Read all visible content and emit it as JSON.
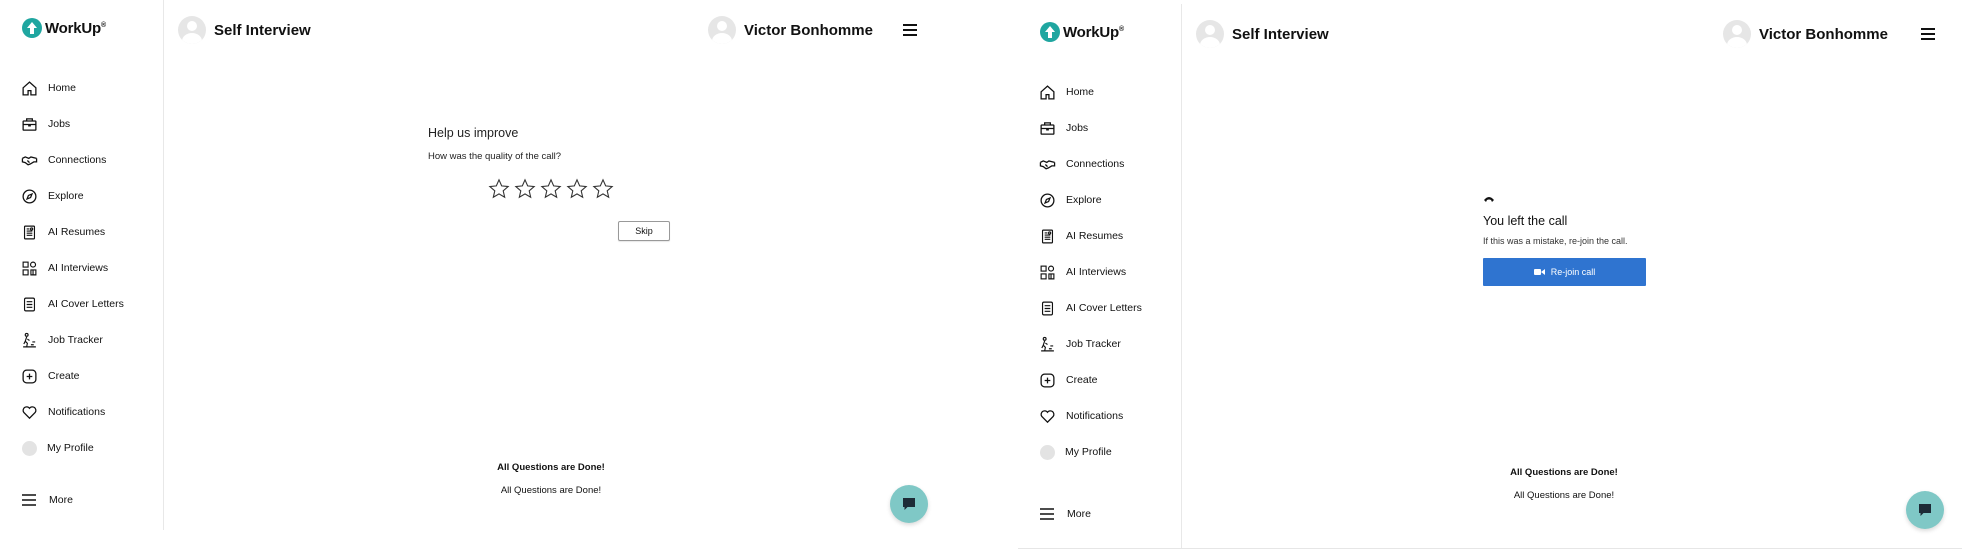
{
  "app": {
    "logo_text": "WorkUp",
    "logo_tm": "®"
  },
  "sidebar": {
    "items": [
      {
        "label": "Home",
        "icon": "home-icon"
      },
      {
        "label": "Jobs",
        "icon": "briefcase-icon"
      },
      {
        "label": "Connections",
        "icon": "handshake-icon"
      },
      {
        "label": "Explore",
        "icon": "compass-icon"
      },
      {
        "label": "AI Resumes",
        "icon": "resume-icon"
      },
      {
        "label": "AI Interviews",
        "icon": "interview-icon"
      },
      {
        "label": "AI Cover Letters",
        "icon": "document-icon"
      },
      {
        "label": "Job Tracker",
        "icon": "tracker-icon"
      },
      {
        "label": "Create",
        "icon": "plus-square-icon"
      },
      {
        "label": "Notifications",
        "icon": "heart-icon"
      },
      {
        "label": "My Profile",
        "icon": "avatar-icon"
      }
    ],
    "more_label": "More"
  },
  "header": {
    "title": "Self Interview",
    "user_name": "Victor Bonhomme"
  },
  "feedback": {
    "title": "Help us improve",
    "question": "How was the quality of the call?",
    "star_count": 5,
    "skip_label": "Skip"
  },
  "left_call": {
    "title": "You left the call",
    "subtitle": "If this was a mistake, re-join the call.",
    "rejoin_label": "Re-join call"
  },
  "status": {
    "done_bold": "All Questions are Done!",
    "done_normal": "All Questions are Done!"
  },
  "colors": {
    "accent_blue": "#2f74d0",
    "chat_teal": "#7fc8c6",
    "logo_teal": "#1fa6a0"
  }
}
